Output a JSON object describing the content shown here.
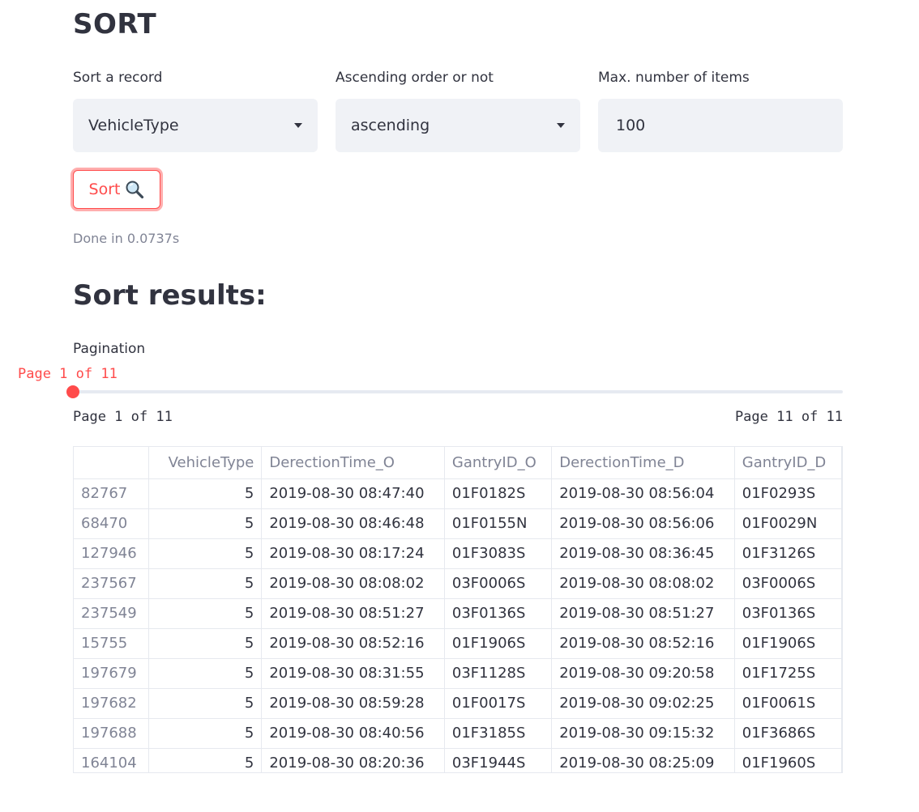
{
  "page_title": "SORT",
  "controls": {
    "sort_record": {
      "label": "Sort a record",
      "value": "VehicleType"
    },
    "order": {
      "label": "Ascending order or not",
      "value": "ascending"
    },
    "max_items": {
      "label": "Max. number of items",
      "value": "100"
    },
    "sort_button": {
      "label": "Sort",
      "icon": "magnifying-glass-icon"
    },
    "status": "Done in 0.0737s"
  },
  "results": {
    "title": "Sort results:",
    "pagination": {
      "label": "Pagination",
      "current_text": "Page 1 of 11",
      "min_text": "Page 1 of 11",
      "max_text": "Page 11 of 11",
      "current": 1,
      "total": 11
    },
    "table": {
      "columns": [
        "",
        "VehicleType",
        "DerectionTime_O",
        "GantryID_O",
        "DerectionTime_D",
        "GantryID_D"
      ],
      "rows": [
        [
          "82767",
          "5",
          "2019-08-30 08:47:40",
          "01F0182S",
          "2019-08-30 08:56:04",
          "01F0293S"
        ],
        [
          "68470",
          "5",
          "2019-08-30 08:46:48",
          "01F0155N",
          "2019-08-30 08:56:06",
          "01F0029N"
        ],
        [
          "127946",
          "5",
          "2019-08-30 08:17:24",
          "01F3083S",
          "2019-08-30 08:36:45",
          "01F3126S"
        ],
        [
          "237567",
          "5",
          "2019-08-30 08:08:02",
          "03F0006S",
          "2019-08-30 08:08:02",
          "03F0006S"
        ],
        [
          "237549",
          "5",
          "2019-08-30 08:51:27",
          "03F0136S",
          "2019-08-30 08:51:27",
          "03F0136S"
        ],
        [
          "15755",
          "5",
          "2019-08-30 08:52:16",
          "01F1906S",
          "2019-08-30 08:52:16",
          "01F1906S"
        ],
        [
          "197679",
          "5",
          "2019-08-30 08:31:55",
          "03F1128S",
          "2019-08-30 09:20:58",
          "01F1725S"
        ],
        [
          "197682",
          "5",
          "2019-08-30 08:59:28",
          "01F0017S",
          "2019-08-30 09:02:25",
          "01F0061S"
        ],
        [
          "197688",
          "5",
          "2019-08-30 08:40:56",
          "01F3185S",
          "2019-08-30 09:15:32",
          "01F3686S"
        ],
        [
          "164104",
          "5",
          "2019-08-30 08:20:36",
          "03F1944S",
          "2019-08-30 08:25:09",
          "01F1960S"
        ]
      ]
    }
  },
  "colors": {
    "accent": "#ff4b4b",
    "input_bg": "#f0f2f6",
    "text": "#31333f",
    "muted": "#808495"
  }
}
